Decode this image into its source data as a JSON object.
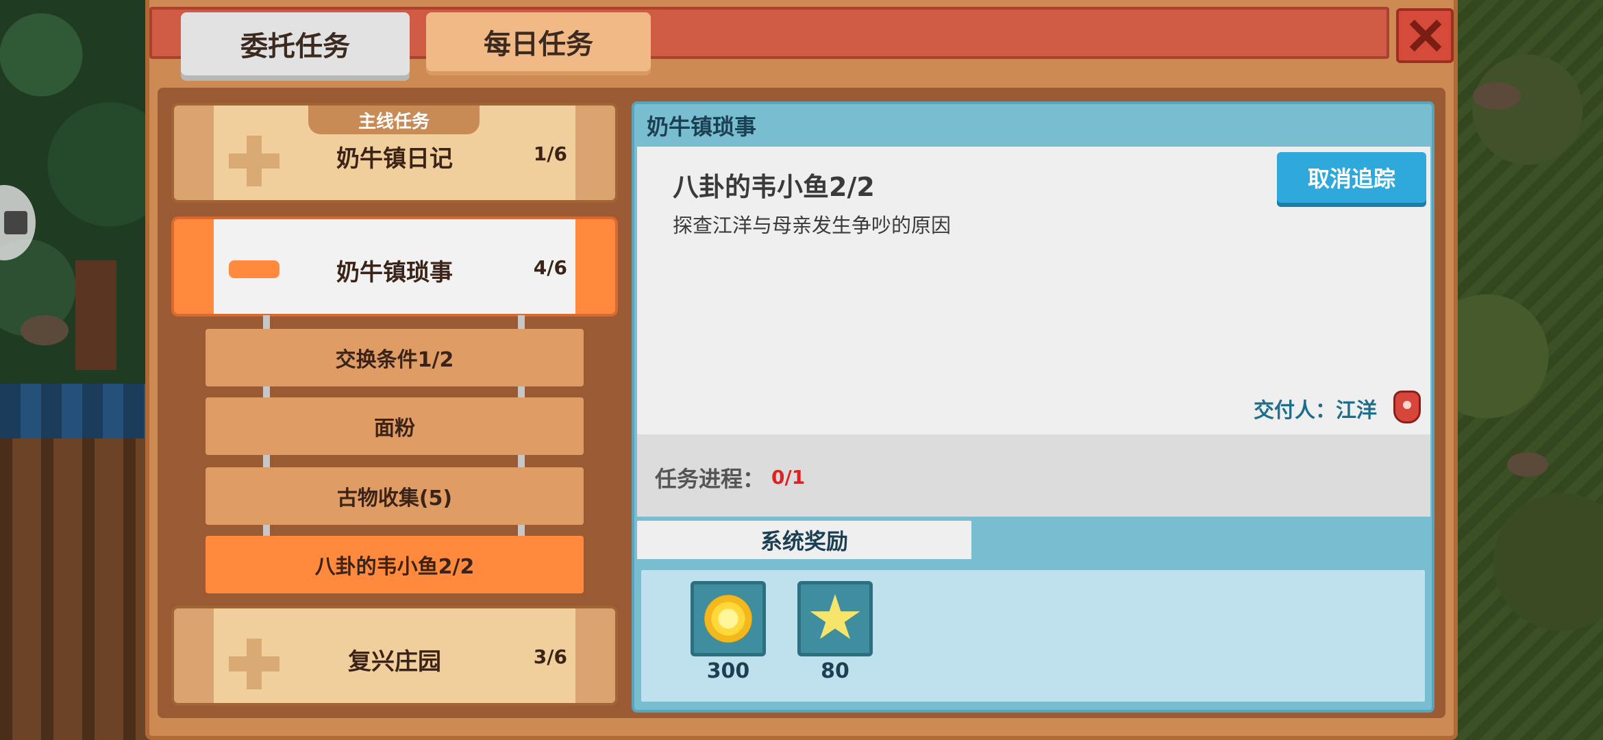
{
  "tabs": {
    "commission": "委托任务",
    "daily": "每日任务"
  },
  "categories": [
    {
      "badge": "主线任务",
      "name": "奶牛镇日记",
      "count": "1/6"
    },
    {
      "name": "奶牛镇琐事",
      "count": "4/6"
    },
    {
      "name": "复兴庄园",
      "count": "3/6"
    }
  ],
  "sub_items": [
    "交换条件1/2",
    "面粉",
    "古物收集(5)",
    "八卦的韦小鱼2/2"
  ],
  "detail": {
    "title": "奶牛镇琐事",
    "task_name": "八卦的韦小鱼2/2",
    "task_desc": "探查江洋与母亲发生争吵的原因",
    "untrack_label": "取消追踪",
    "giver": "交付人：江洋",
    "progress_label": "任务进程：",
    "progress_value": "0/1",
    "reward_tab": "系统奖励",
    "rewards": [
      {
        "icon": "coin-icon",
        "amount": "300"
      },
      {
        "icon": "star-icon",
        "amount": "80"
      }
    ]
  },
  "colors": {
    "accent_orange": "#ff8a3d",
    "panel": "#cd8a52",
    "detail_blue": "#79bdd0",
    "button_blue": "#2fa9db",
    "progress_red": "#dd2222"
  }
}
